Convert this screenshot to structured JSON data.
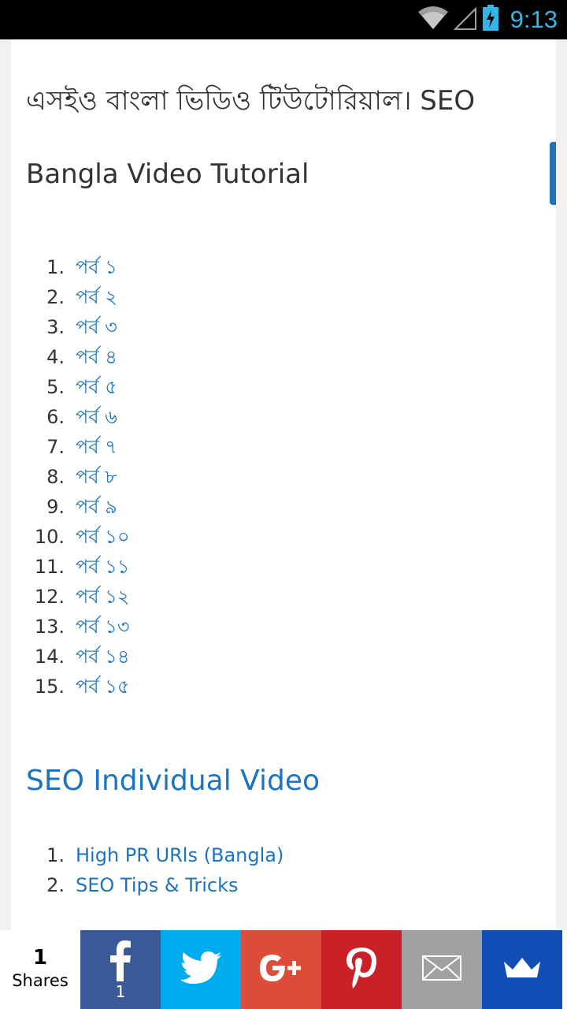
{
  "status_bar": {
    "time": "9:13"
  },
  "page": {
    "title": "এসইও বাংলা ভিডিও টিউটোরিয়াল। SEO Bangla Video Tutorial",
    "parts": [
      {
        "num": "1.",
        "label": "পর্ব ১"
      },
      {
        "num": "2.",
        "label": "পর্ব ২"
      },
      {
        "num": "3.",
        "label": "পর্ব ৩"
      },
      {
        "num": "4.",
        "label": "পর্ব ৪"
      },
      {
        "num": "5.",
        "label": "পর্ব ৫"
      },
      {
        "num": "6.",
        "label": "পর্ব ৬"
      },
      {
        "num": "7.",
        "label": "পর্ব ৭"
      },
      {
        "num": "8.",
        "label": "পর্ব ৮"
      },
      {
        "num": "9.",
        "label": "পর্ব ৯"
      },
      {
        "num": "10.",
        "label": "পর্ব ১০"
      },
      {
        "num": "11.",
        "label": "পর্ব ১১"
      },
      {
        "num": "12.",
        "label": "পর্ব ১২"
      },
      {
        "num": "13.",
        "label": "পর্ব ১৩"
      },
      {
        "num": "14.",
        "label": "পর্ব ১৪"
      },
      {
        "num": "15.",
        "label": "পর্ব ১৫"
      }
    ],
    "section_heading": "SEO Individual Video",
    "videos": [
      {
        "num": "1.",
        "label": "High PR URls (Bangla)"
      },
      {
        "num": "2.",
        "label": "SEO Tips & Tricks"
      }
    ]
  },
  "share_bar": {
    "count": "1",
    "count_label": "Shares",
    "facebook_count": "1",
    "buttons": [
      {
        "name": "facebook",
        "icon": "facebook-icon",
        "color": "#3b5998"
      },
      {
        "name": "twitter",
        "icon": "twitter-icon",
        "color": "#00aced"
      },
      {
        "name": "google-plus",
        "icon": "google-plus-icon",
        "color": "#dd4b39"
      },
      {
        "name": "pinterest",
        "icon": "pinterest-icon",
        "color": "#cb2027"
      },
      {
        "name": "email",
        "icon": "email-icon",
        "color": "#a0a0a0"
      },
      {
        "name": "crown",
        "icon": "crown-icon",
        "color": "#104db4"
      }
    ]
  },
  "colors": {
    "link": "#1e73be",
    "text": "#333333",
    "status_accent": "#33b5e5"
  }
}
